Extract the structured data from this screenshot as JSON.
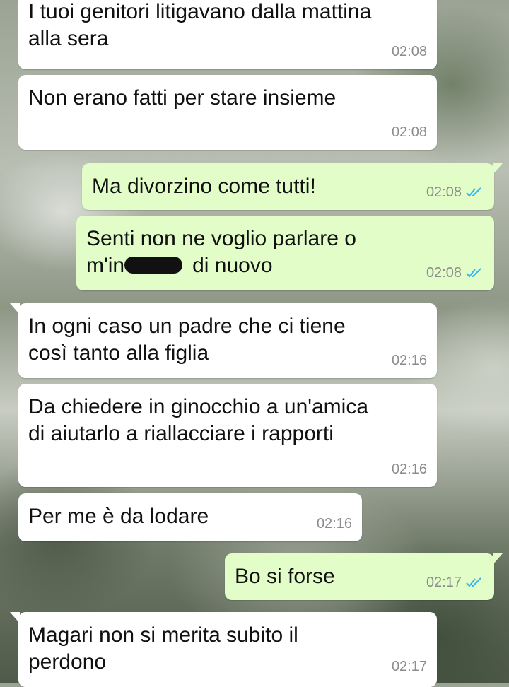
{
  "colors": {
    "incoming_bubble": "#ffffff",
    "outgoing_bubble": "#e2fdc8",
    "read_ticks": "#34b7f1",
    "timestamp": "#8c8c8c"
  },
  "messages": [
    {
      "direction": "incoming",
      "text": "I tuoi genitori litigavano dalla mattina\nalla sera",
      "time": "02:08"
    },
    {
      "direction": "incoming",
      "text": "Non erano fatti per stare insieme",
      "time": "02:08"
    },
    {
      "direction": "outgoing",
      "text": "Ma divorzino come tutti!",
      "time": "02:08",
      "status_icon": "double-check-read-icon"
    },
    {
      "direction": "outgoing",
      "text_line1": "Senti non ne voglio parlare o",
      "text_line2_prefix": "m'in",
      "text_line2_suffix": "di nuovo",
      "time": "02:08",
      "status_icon": "double-check-read-icon"
    },
    {
      "direction": "incoming",
      "text": "In ogni caso un padre che ci tiene\ncosì tanto alla figlia",
      "time": "02:16"
    },
    {
      "direction": "incoming",
      "text": "Da chiedere in ginocchio a un'amica\ndi aiutarlo a riallacciare i rapporti",
      "time": "02:16"
    },
    {
      "direction": "incoming",
      "text": "Per me è da lodare",
      "time": "02:16"
    },
    {
      "direction": "outgoing",
      "text": "Bo si forse",
      "time": "02:17",
      "status_icon": "double-check-read-icon"
    },
    {
      "direction": "incoming",
      "text": "Magari non si merita subito il\nperdono",
      "time": "02:17"
    }
  ]
}
